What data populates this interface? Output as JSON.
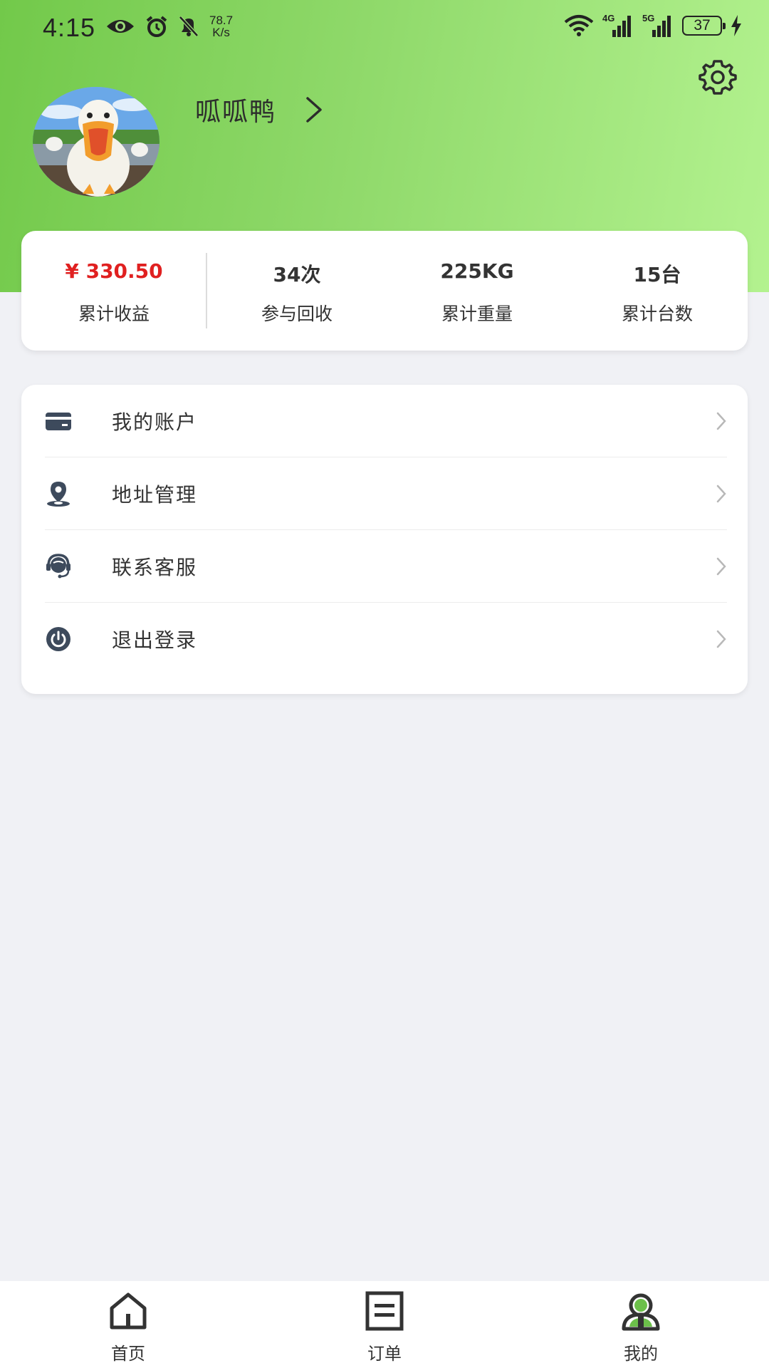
{
  "status_bar": {
    "time": "4:15",
    "net_speed_value": "78.7",
    "net_speed_unit": "K/s",
    "signal_1": "4G",
    "signal_2": "5G",
    "battery": "37"
  },
  "profile": {
    "name": "呱呱鸭"
  },
  "stats": [
    {
      "value": "¥ 330.50",
      "label": "累计收益"
    },
    {
      "value": "34次",
      "label": "参与回收"
    },
    {
      "value": "225KG",
      "label": "累计重量"
    },
    {
      "value": "15台",
      "label": "累计台数"
    }
  ],
  "menu": [
    {
      "label": "我的账户",
      "icon": "card-icon"
    },
    {
      "label": "地址管理",
      "icon": "location-icon"
    },
    {
      "label": "联系客服",
      "icon": "headset-icon"
    },
    {
      "label": "退出登录",
      "icon": "power-icon"
    }
  ],
  "nav": [
    {
      "label": "首页",
      "icon": "home-icon"
    },
    {
      "label": "订单",
      "icon": "orders-icon"
    },
    {
      "label": "我的",
      "icon": "profile-icon",
      "active": true
    }
  ],
  "colors": {
    "header_gradient_start": "#72c94a",
    "header_gradient_end": "#b3f28f",
    "money": "#e02020",
    "icon": "#3d4a5c",
    "active_nav_accent": "#6cc04a"
  }
}
